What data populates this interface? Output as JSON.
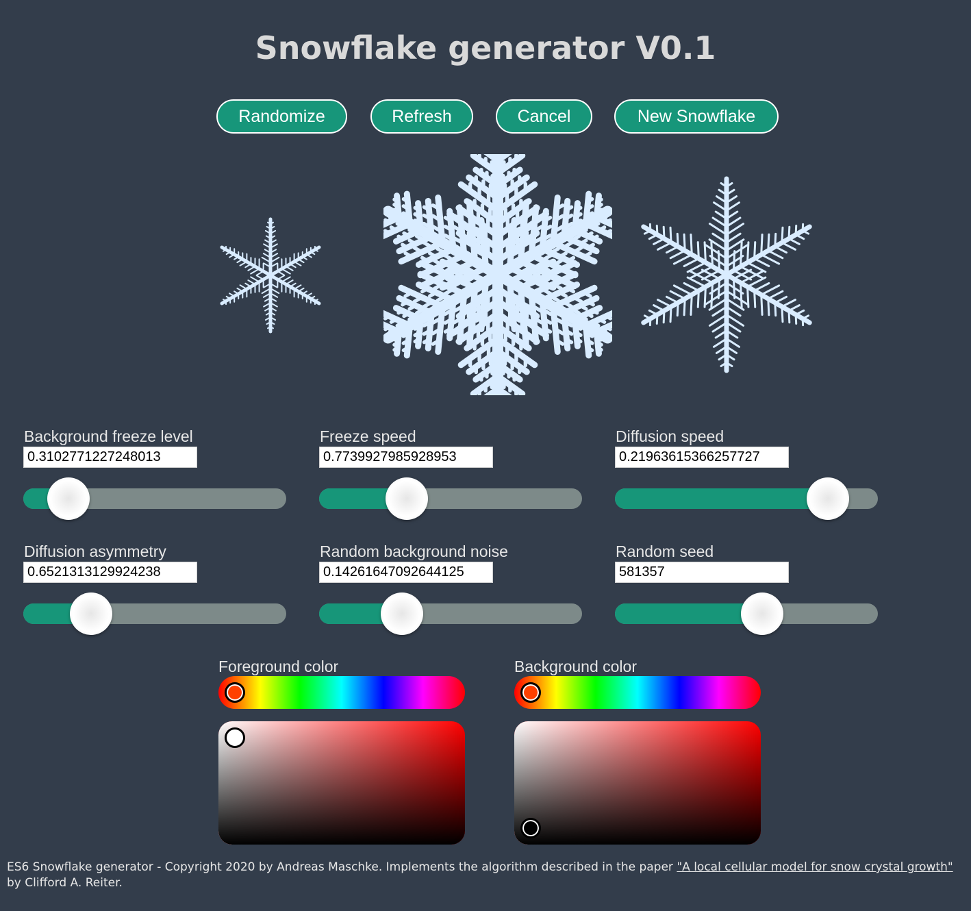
{
  "title": "Snowflake generator V0.1",
  "buttons": {
    "randomize": "Randomize",
    "refresh": "Refresh",
    "cancel": "Cancel",
    "new_snowflake": "New Snowflake"
  },
  "params": [
    {
      "label": "Background freeze level",
      "value": "0.3102771227248013",
      "fill": 0.11
    },
    {
      "label": "Freeze speed",
      "value": "0.7739927985928953",
      "fill": 0.3
    },
    {
      "label": "Diffusion speed",
      "value": "0.21963615366257727",
      "fill": 0.87
    },
    {
      "label": "Diffusion asymmetry",
      "value": "0.6521313129924238",
      "fill": 0.21
    },
    {
      "label": "Random background noise",
      "value": "0.14261647092644125",
      "fill": 0.28
    },
    {
      "label": "Random seed",
      "value": "581357",
      "fill": 0.57
    }
  ],
  "color_pickers": {
    "foreground": {
      "label": "Foreground color",
      "hue_color": "#ff4000",
      "value_color": "#ffffff"
    },
    "background": {
      "label": "Background color",
      "hue_color": "#ff4000",
      "value_color": "#000000"
    }
  },
  "colors": {
    "page_bg": "#333d4b",
    "accent": "#17967a",
    "snowflake": "#d9ecff"
  },
  "footer": {
    "prefix": "ES6 Snowflake generator - Copyright 2020 by Andreas Maschke. Implements the algorithm described in the paper ",
    "link": "\"A local cellular model for snow crystal growth\"",
    "suffix": " by Clifford A. Reiter."
  }
}
